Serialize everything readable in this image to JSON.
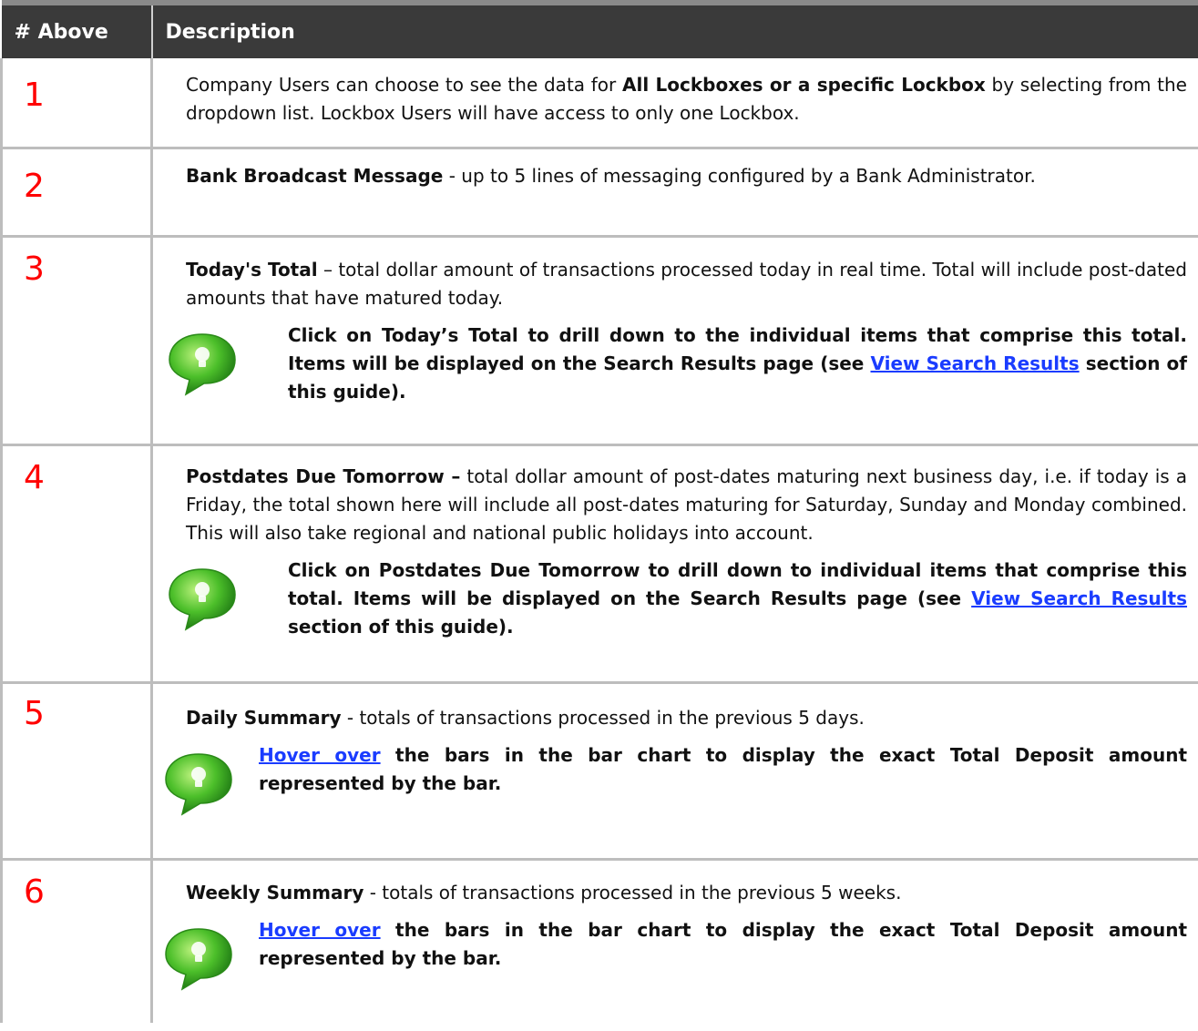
{
  "header": {
    "col1": "# Above",
    "col2": "Description"
  },
  "rows": [
    {
      "num": "1",
      "parts": [
        "Company Users can choose to see the data for ",
        "All Lockboxes or a specific Lockbox",
        " by selecting from the dropdown list. Lockbox Users will have access to only one Lockbox."
      ]
    },
    {
      "num": "2",
      "title": "Bank Broadcast Message",
      "text": " - up to 5 lines of messaging configured by a Bank Administrator."
    },
    {
      "num": "3",
      "title": "Today's Total",
      "text": " – total dollar amount of transactions processed today in real time. Total will include post-dated amounts that have matured today.",
      "tip_pre": "Click on Today’s Total to drill down to the individual items that comprise this total. Items will be displayed on the Search Results page (see ",
      "tip_link": "View Search Results",
      "tip_post": " section of this guide)."
    },
    {
      "num": "4",
      "title": "Postdates Due Tomorrow –",
      "text": " total dollar amount of post-dates maturing next business day, i.e. if today is a Friday, the total shown here will include all post-dates maturing for Saturday, Sunday and Monday combined. This will also take regional and national public holidays into account.",
      "tip_pre": "Click on Postdates Due Tomorrow to drill down to individual items that comprise this total. Items will be displayed on the Search Results page (see ",
      "tip_link": "View Search Results",
      "tip_post": " section of this guide)."
    },
    {
      "num": "5",
      "title": "Daily Summary",
      "text": " - totals of transactions processed in the previous 5 days.",
      "tip_link": "Hover over",
      "tip_post": " the bars in the bar chart to display the exact Total Deposit amount represented by the bar."
    },
    {
      "num": "6",
      "title": "Weekly Summary",
      "text": " - totals of transactions processed in the previous 5 weeks.",
      "tip_link": "Hover over",
      "tip_post": " the bars in the bar chart to display the exact Total Deposit amount represented by the bar."
    }
  ],
  "icons": {
    "tip": "lightbulb-speech-bubble-icon"
  },
  "colors": {
    "number": "#ff0000",
    "header_bg": "#3a3a3a",
    "link": "#1a3cff",
    "bubble": "#3fae2a"
  }
}
